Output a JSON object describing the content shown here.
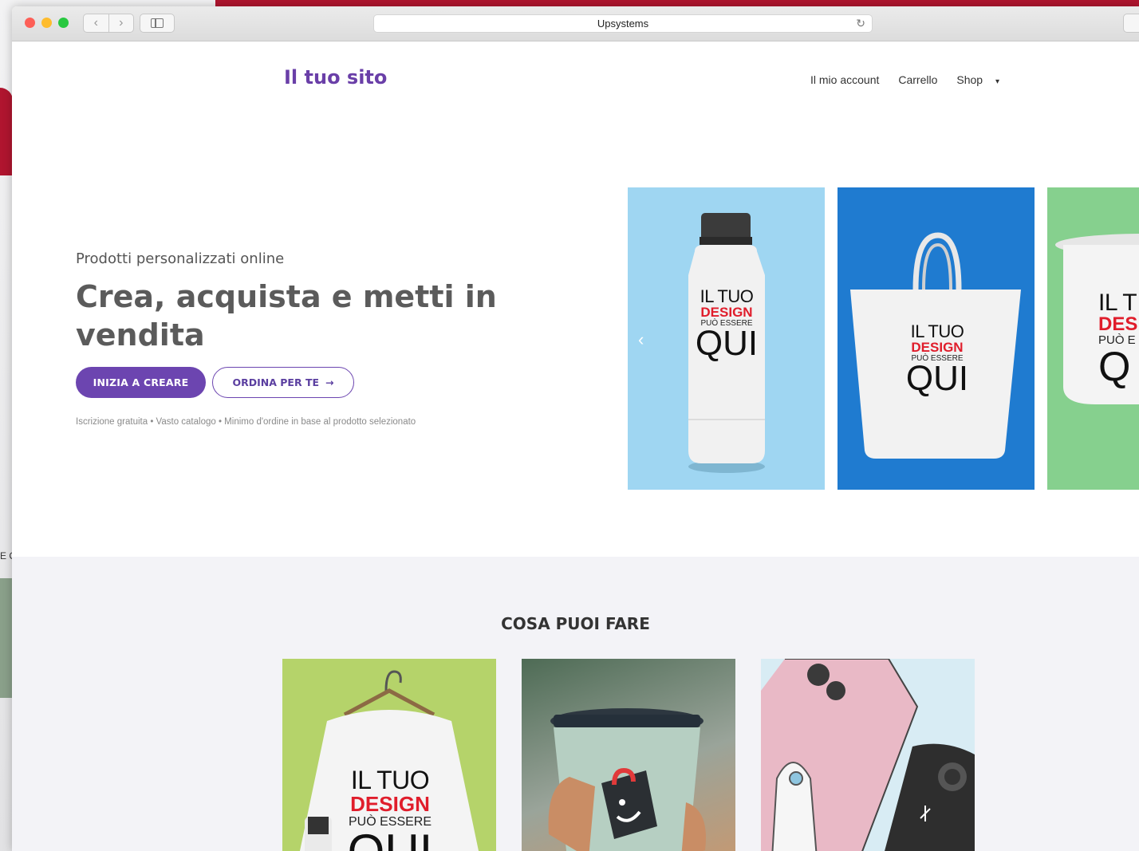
{
  "browser": {
    "address_text": "Upsystems",
    "back_icon": "chevron-left-icon",
    "forward_icon": "chevron-right-icon",
    "sidebar_icon": "sidebar-icon",
    "reload_icon": "reload-icon",
    "share_icon": "share-icon"
  },
  "header": {
    "logo": "Il tuo sito",
    "menu": {
      "account": "Il mio account",
      "cart": "Carrello",
      "shop": "Shop",
      "shop_caret": "▾"
    }
  },
  "hero": {
    "kicker": "Prodotti personalizzati online",
    "headline": "Crea, acquista e metti in vendita",
    "primary_cta": "INIZIA A CREARE",
    "secondary_cta": "ORDINA PER TE",
    "secondary_arrow": "→",
    "features": "Iscrizione gratuita • Vasto catalogo • Minimo d'ordine in base al prodotto selezionato",
    "carousel_prev": "‹"
  },
  "mockup_text": {
    "line1": "IL TUO",
    "line2": "DESIGN",
    "line3": "PUÒ ESSERE",
    "line4": "QUI"
  },
  "cropped": {
    "line1": "IL T",
    "line2": "DES",
    "line3": "PUÒ E",
    "line4": "Q"
  },
  "section": {
    "title": "COSA PUOI FARE"
  },
  "backdrop": {
    "text": "E C"
  },
  "colors": {
    "accent": "#6c45b0",
    "logo": "#6a3fa8",
    "design_red": "#e01d2b",
    "slide_1": "#9fd6f2",
    "slide_2": "#1f7bd0",
    "slide_3": "#86d08e",
    "card_1": "#b5d36a"
  }
}
